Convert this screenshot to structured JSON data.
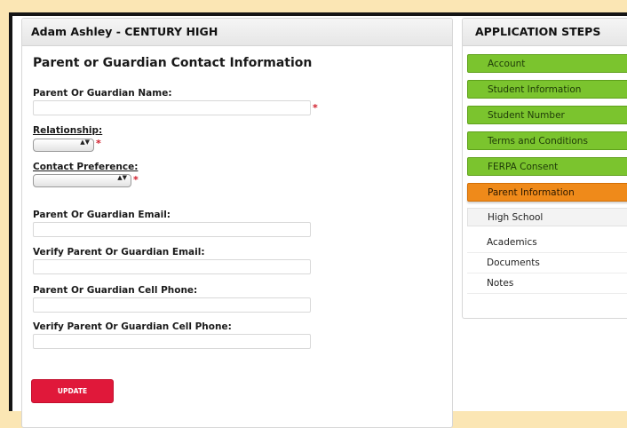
{
  "form": {
    "header": "Adam Ashley - CENTURY HIGH",
    "title": "Parent or Guardian Contact Information",
    "fields": {
      "guardian_name_label": "Parent Or Guardian Name:",
      "relationship_label": "Relationship:",
      "contact_pref_label": "Contact Preference:",
      "email_label": "Parent Or Guardian Email:",
      "verify_email_label": "Verify Parent Or Guardian Email:",
      "cell_label": "Parent Or Guardian Cell Phone:",
      "verify_cell_label": "Verify Parent Or Guardian Cell Phone:"
    },
    "required_mark": "*",
    "select_arrows": "▲▼",
    "update_label": "UPDATE"
  },
  "steps": {
    "header": "APPLICATION STEPS",
    "items": [
      {
        "label": "Account",
        "status": "complete"
      },
      {
        "label": "Student Information",
        "status": "complete"
      },
      {
        "label": "Student Number",
        "status": "complete"
      },
      {
        "label": "Terms and Conditions",
        "status": "complete"
      },
      {
        "label": "FERPA Consent",
        "status": "complete"
      },
      {
        "label": "Parent Information",
        "status": "current"
      },
      {
        "label": "High School",
        "status": "next"
      },
      {
        "label": "Academics",
        "status": "pending"
      },
      {
        "label": "Documents",
        "status": "pending"
      },
      {
        "label": "Notes",
        "status": "pending"
      }
    ]
  },
  "colors": {
    "complete": "#7bc42e",
    "current": "#ef8a1a",
    "required": "#d01c2a",
    "button": "#e0183a",
    "background": "#fbe6b4"
  }
}
